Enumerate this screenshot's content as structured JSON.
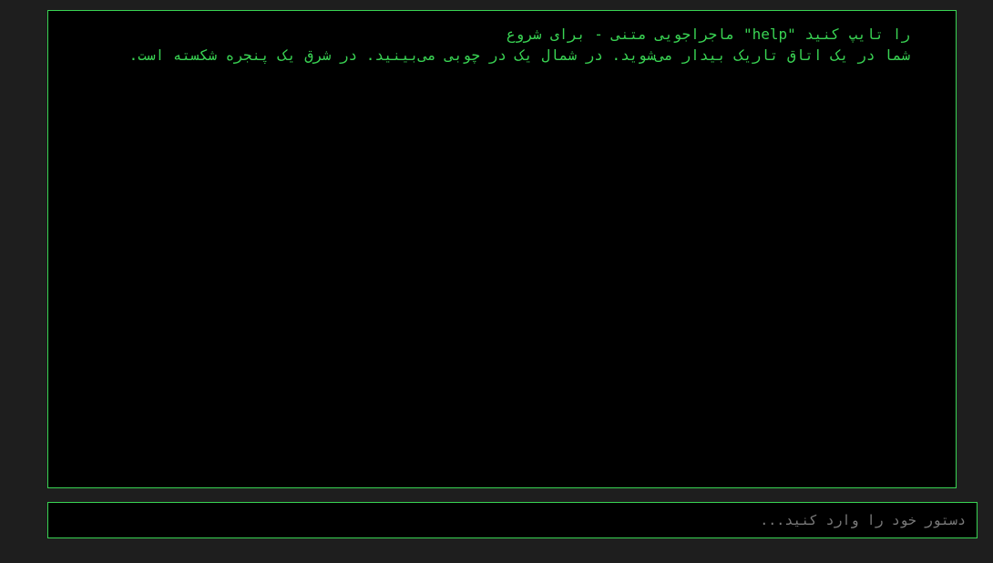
{
  "terminal": {
    "lines": [
      "را تایپ کنید \"help\" ماجراجویی متنی - برای شروع",
      "شما در یک اتاق تاریک بیدار می‌شوید. در شمال یک در چوبی می‌بینید. در شرق یک پنجره شکسته است."
    ]
  },
  "command": {
    "value": "",
    "placeholder": "دستور خود را وارد کنید..."
  },
  "colors": {
    "background": "#1e1e1e",
    "terminal_bg": "#000000",
    "accent": "#39d353",
    "placeholder": "#7a7a7a"
  }
}
